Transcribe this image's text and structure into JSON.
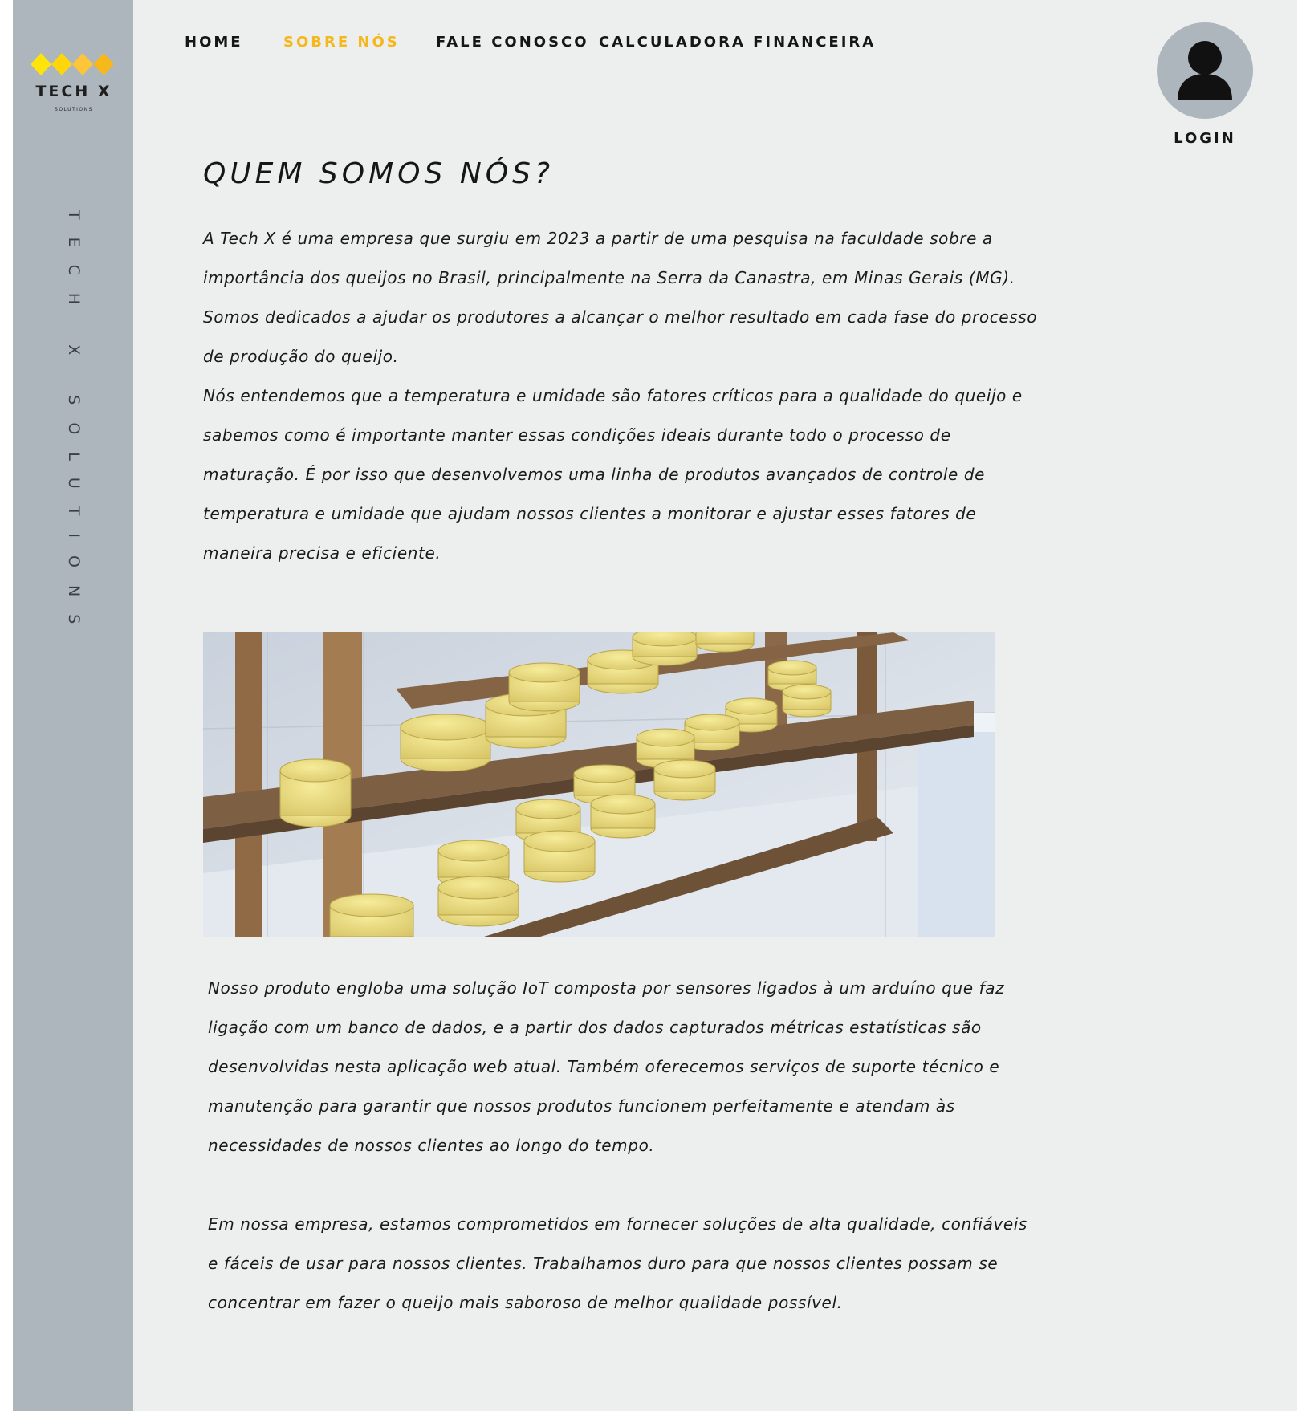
{
  "brand": {
    "logo_name": "TECH X",
    "logo_subtitle": "SOLUTIONS",
    "vertical_text": "TECH X SOLUTIONS",
    "colors": {
      "sidebar": "#adb5bd",
      "background": "#edefee",
      "accent": "#f5b71b",
      "diamond_yellow": "#ffe40a",
      "diamond_gold": "#f7b81c"
    }
  },
  "nav": {
    "items": [
      {
        "label": "HOME",
        "active": false
      },
      {
        "label": "SOBRE NÓS",
        "active": true
      },
      {
        "label": "FALE CONOSCO",
        "active": false
      },
      {
        "label": "CALCULADORA FINANCEIRA",
        "active": false
      }
    ]
  },
  "login": {
    "label": "LOGIN",
    "icon": "user-avatar-icon"
  },
  "main": {
    "title": "QUEM SOMOS NÓS?",
    "intro_paragraphs": [
      "A Tech X é uma empresa  que surgiu em  2023 a partir de uma pesquisa na faculdade sobre a importância dos queijos no Brasil, principalmente na Serra da Canastra, em Minas Gerais (MG).",
      "Somos dedicados a ajudar os produtores a alcançar o melhor resultado em cada fase do processo de produção do queijo.",
      "Nós entendemos que a temperatura e umidade são fatores críticos para a qualidade do queijo e sabemos como é importante manter essas condições ideais durante todo o processo de maturação. É por isso que desenvolvemos uma linha de produtos avançados de controle de temperatura e umidade que ajudam nossos clientes a monitorar e ajustar esses fatores de maneira precisa e eficiente."
    ],
    "image": "cheese-maturation-shelves",
    "body_paragraphs": [
      "Nosso produto engloba uma solução IoT composta por sensores ligados à um arduíno que faz ligação com um banco de dados, e a partir dos dados capturados métricas estatísticas são desenvolvidas nesta aplicação web atual. Também oferecemos serviços de suporte técnico e manutenção para garantir que nossos produtos funcionem perfeitamente e atendam às necessidades de nossos clientes ao longo do tempo.",
      "Em nossa empresa, estamos comprometidos em fornecer soluções de alta qualidade, confiáveis e fáceis de usar para nossos clientes. Trabalhamos duro para que nossos clientes possam se concentrar em fazer o queijo mais saboroso  de melhor qualidade possível."
    ]
  }
}
